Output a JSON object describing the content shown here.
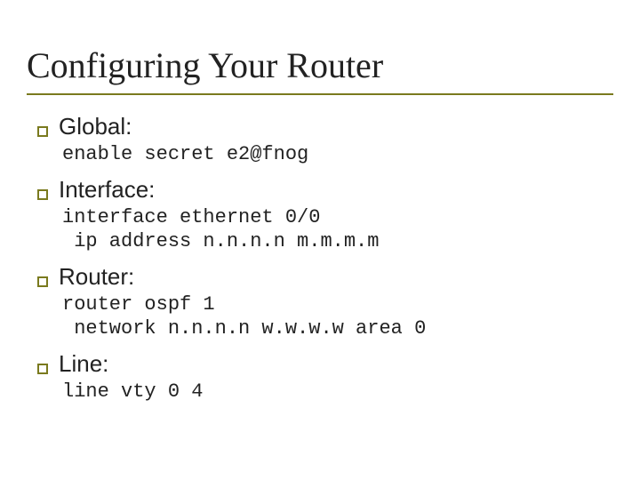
{
  "title": "Configuring Your Router",
  "sections": [
    {
      "label": "Global:",
      "code": "enable secret e2@fnog"
    },
    {
      "label": "Interface:",
      "code": "interface ethernet 0/0\n ip address n.n.n.n m.m.m.m"
    },
    {
      "label": "Router:",
      "code": "router ospf 1\n network n.n.n.n w.w.w.w area 0"
    },
    {
      "label": "Line:",
      "code": "line vty 0 4"
    }
  ]
}
